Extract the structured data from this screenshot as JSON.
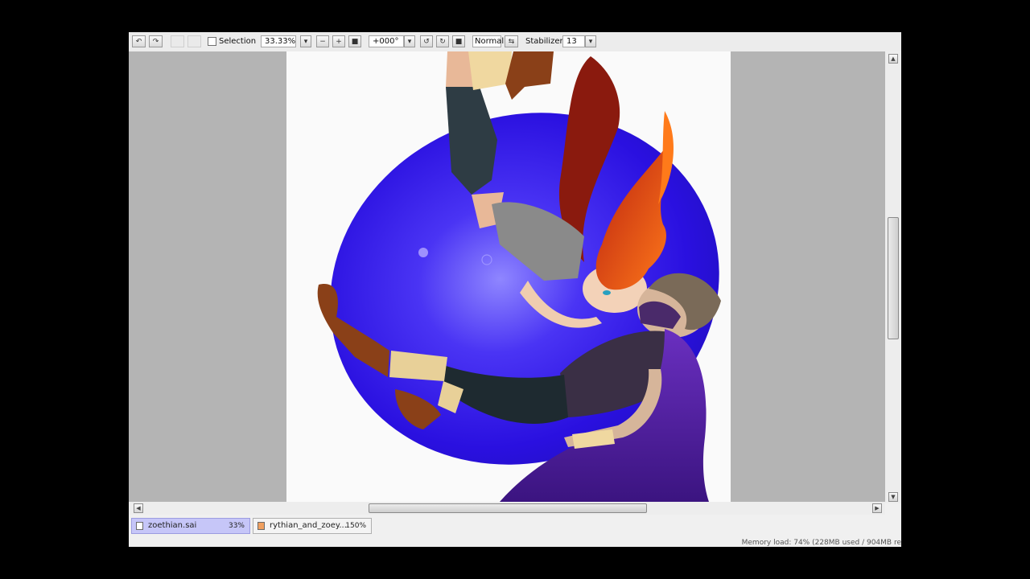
{
  "toolbar": {
    "selection_label": "Selection",
    "zoom_value": "33.33%",
    "rotation_value": "+000°",
    "blend_mode": "Normal",
    "stabilizer_label": "Stabilizer",
    "stabilizer_value": "13"
  },
  "tabs": [
    {
      "name": "zoethian.sai",
      "zoom": "33%",
      "active": true
    },
    {
      "name": "rythian_and_zoey...",
      "zoom": "150%",
      "active": false
    }
  ],
  "status": {
    "memory_load": "Memory load: 74% (228MB used / 904MB re"
  },
  "colors": {
    "app_background": "#f0f0f0",
    "canvas_gray": "#b4b4b4",
    "active_tab": "#c6c6f8",
    "artwork_blue": "#2a10e0",
    "cape_purple": "#5a1fa8",
    "hair_orange": "#f05a10"
  },
  "icons": [
    "undo-icon",
    "redo-icon",
    "zoom-dropdown-icon",
    "zoom-out-icon",
    "zoom-in-icon",
    "zoom-reset-icon",
    "rotate-dropdown-icon",
    "rotate-left-icon",
    "rotate-right-icon",
    "rotate-reset-icon",
    "flip-icon",
    "stabilizer-dropdown-icon",
    "file-icon",
    "scroll-up-icon",
    "scroll-down-icon",
    "scroll-left-icon",
    "scroll-right-icon"
  ]
}
